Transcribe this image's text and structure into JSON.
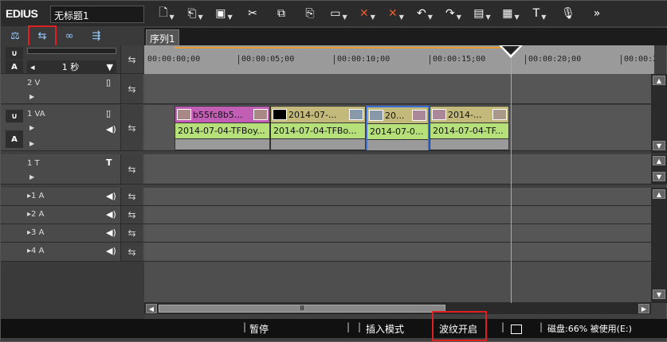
{
  "app": {
    "logo": "EDIUS",
    "project_title": "无标题1"
  },
  "toolbar": {
    "icons": [
      "new-project-icon",
      "open-icon",
      "save-icon",
      "cut-icon",
      "copy-icon",
      "paste-icon",
      "range-icon",
      "delete-red-icon",
      "ripple-delete-red-icon",
      "undo-icon",
      "redo-icon",
      "render-icon",
      "sequence-icon",
      "title-icon",
      "mic-icon",
      "more-icon"
    ]
  },
  "left_tools": {
    "icons": [
      "marker-icon",
      "sync-lock-icon",
      "link-icon",
      "ripple-icon"
    ]
  },
  "sequence": {
    "tab": "序列1"
  },
  "scale": {
    "label": "1 秒"
  },
  "ruler": {
    "ticks": [
      "00:00:00;00",
      "00:00:05;00",
      "00:00:10;00",
      "00:00:15;00",
      "00:00:20;00",
      "00:00:2"
    ]
  },
  "tracks": [
    {
      "name": "2 V"
    },
    {
      "name": "1 VA",
      "sub": "A"
    },
    {
      "name": "1 T"
    },
    {
      "name": "1 A"
    },
    {
      "name": "2 A"
    },
    {
      "name": "3 A"
    },
    {
      "name": "4 A"
    }
  ],
  "clips": [
    {
      "video": "b55fc8b5...",
      "audio": "2014-07-04-TFBoy...",
      "color": "#c25fb5"
    },
    {
      "video": "2014-07-...",
      "audio": "2014-07-04-TFBo...",
      "color": "#c2b97a"
    },
    {
      "video": "20...",
      "audio": "2014-07-0...",
      "color": "#c2b97a"
    },
    {
      "video": "2014-...",
      "audio": "2014-07-04-TF...",
      "color": "#c2b97a"
    }
  ],
  "status": {
    "pause": "暂停",
    "insert_mode": "插入模式",
    "ripple": "波纹开启",
    "disk": "磁盘:66% 被使用(E:)"
  }
}
